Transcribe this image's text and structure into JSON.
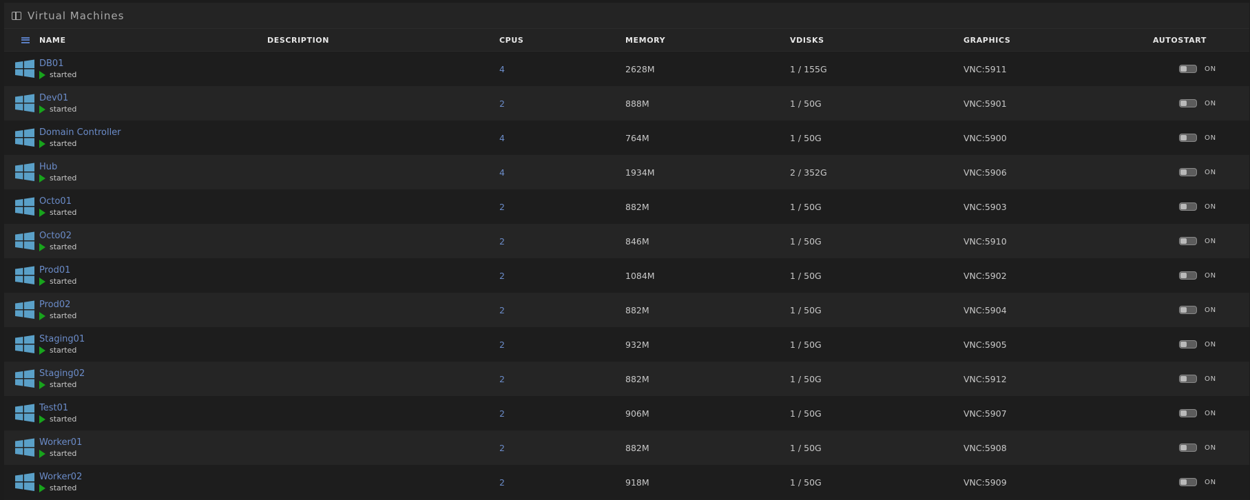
{
  "panel": {
    "title": "Virtual Machines",
    "icon": "panel-icon"
  },
  "table": {
    "headers": {
      "name": "NAME",
      "description": "DESCRIPTION",
      "cpus": "CPUS",
      "memory": "MEMORY",
      "vdisks": "VDISKS",
      "graphics": "GRAPHICS",
      "autostart": "AUTOSTART"
    },
    "rows": [
      {
        "name": "DB01",
        "status": "started",
        "description": "",
        "cpus": "4",
        "memory": "2628M",
        "vdisks": "1 / 155G",
        "graphics": "VNC:5911",
        "autostart": "ON"
      },
      {
        "name": "Dev01",
        "status": "started",
        "description": "",
        "cpus": "2",
        "memory": "888M",
        "vdisks": "1 / 50G",
        "graphics": "VNC:5901",
        "autostart": "ON"
      },
      {
        "name": "Domain Controller",
        "status": "started",
        "description": "",
        "cpus": "4",
        "memory": "764M",
        "vdisks": "1 / 50G",
        "graphics": "VNC:5900",
        "autostart": "ON"
      },
      {
        "name": "Hub",
        "status": "started",
        "description": "",
        "cpus": "4",
        "memory": "1934M",
        "vdisks": "2 / 352G",
        "graphics": "VNC:5906",
        "autostart": "ON"
      },
      {
        "name": "Octo01",
        "status": "started",
        "description": "",
        "cpus": "2",
        "memory": "882M",
        "vdisks": "1 / 50G",
        "graphics": "VNC:5903",
        "autostart": "ON"
      },
      {
        "name": "Octo02",
        "status": "started",
        "description": "",
        "cpus": "2",
        "memory": "846M",
        "vdisks": "1 / 50G",
        "graphics": "VNC:5910",
        "autostart": "ON"
      },
      {
        "name": "Prod01",
        "status": "started",
        "description": "",
        "cpus": "2",
        "memory": "1084M",
        "vdisks": "1 / 50G",
        "graphics": "VNC:5902",
        "autostart": "ON"
      },
      {
        "name": "Prod02",
        "status": "started",
        "description": "",
        "cpus": "2",
        "memory": "882M",
        "vdisks": "1 / 50G",
        "graphics": "VNC:5904",
        "autostart": "ON"
      },
      {
        "name": "Staging01",
        "status": "started",
        "description": "",
        "cpus": "2",
        "memory": "932M",
        "vdisks": "1 / 50G",
        "graphics": "VNC:5905",
        "autostart": "ON"
      },
      {
        "name": "Staging02",
        "status": "started",
        "description": "",
        "cpus": "2",
        "memory": "882M",
        "vdisks": "1 / 50G",
        "graphics": "VNC:5912",
        "autostart": "ON"
      },
      {
        "name": "Test01",
        "status": "started",
        "description": "",
        "cpus": "2",
        "memory": "906M",
        "vdisks": "1 / 50G",
        "graphics": "VNC:5907",
        "autostart": "ON"
      },
      {
        "name": "Worker01",
        "status": "started",
        "description": "",
        "cpus": "2",
        "memory": "882M",
        "vdisks": "1 / 50G",
        "graphics": "VNC:5908",
        "autostart": "ON"
      },
      {
        "name": "Worker02",
        "status": "started",
        "description": "",
        "cpus": "2",
        "memory": "918M",
        "vdisks": "1 / 50G",
        "graphics": "VNC:5909",
        "autostart": "ON"
      }
    ]
  },
  "icons": {
    "row_icon": "windows-icon",
    "status_icon": "play-icon",
    "header_icon": "list-icon"
  },
  "colors": {
    "link": "#6b8cc9",
    "started": "#18a31c",
    "windows_logo": "#5aa0c8",
    "background": "#1c1c1c"
  }
}
